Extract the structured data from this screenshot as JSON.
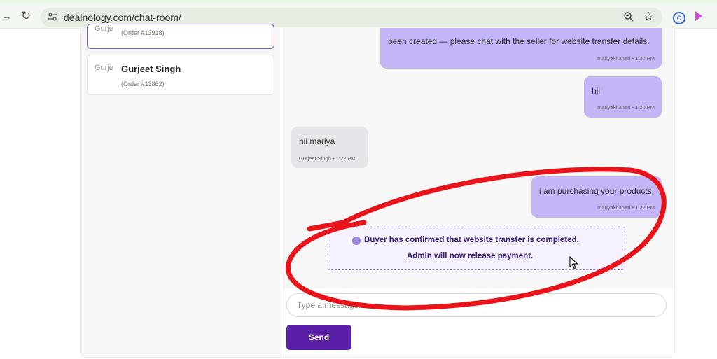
{
  "browser": {
    "url": "dealnology.com/chat-room/",
    "icons": [
      "forward-icon",
      "reload-icon",
      "site-settings-icon",
      "zoom-icon",
      "star-icon",
      "extension-icon",
      "extension-icon"
    ]
  },
  "sidebar": {
    "contacts": [
      {
        "avatar_alt": "Gurje",
        "name": "",
        "order": "(Order #13918)"
      },
      {
        "avatar_alt": "Gurje",
        "name": "Gurjeet Singh",
        "order": "(Order #13862)"
      }
    ]
  },
  "messages": [
    {
      "direction": "out",
      "text": "been created — please chat with the seller for website transfer details.",
      "meta": "mariyakhanari • 1:20 PM"
    },
    {
      "direction": "out",
      "text": "hii",
      "meta": "mariyakhanari • 1:20 PM"
    },
    {
      "direction": "in",
      "text": "hii mariya",
      "meta": "Gurjeet Singh • 1:22 PM"
    },
    {
      "direction": "out",
      "text": "i am purchasing your products",
      "meta": "mariyakhanari • 1:22 PM"
    }
  ],
  "notice": {
    "line1": "Buyer has confirmed that website transfer is completed.",
    "line2": "Admin will now release payment."
  },
  "composer": {
    "placeholder": "Type a message...",
    "send_label": "Send"
  },
  "colors": {
    "accent": "#5a1fa6",
    "outgoing_bubble": "#c4b5f7",
    "incoming_bubble": "#e6e6ea",
    "annotation": "#e8141a"
  }
}
